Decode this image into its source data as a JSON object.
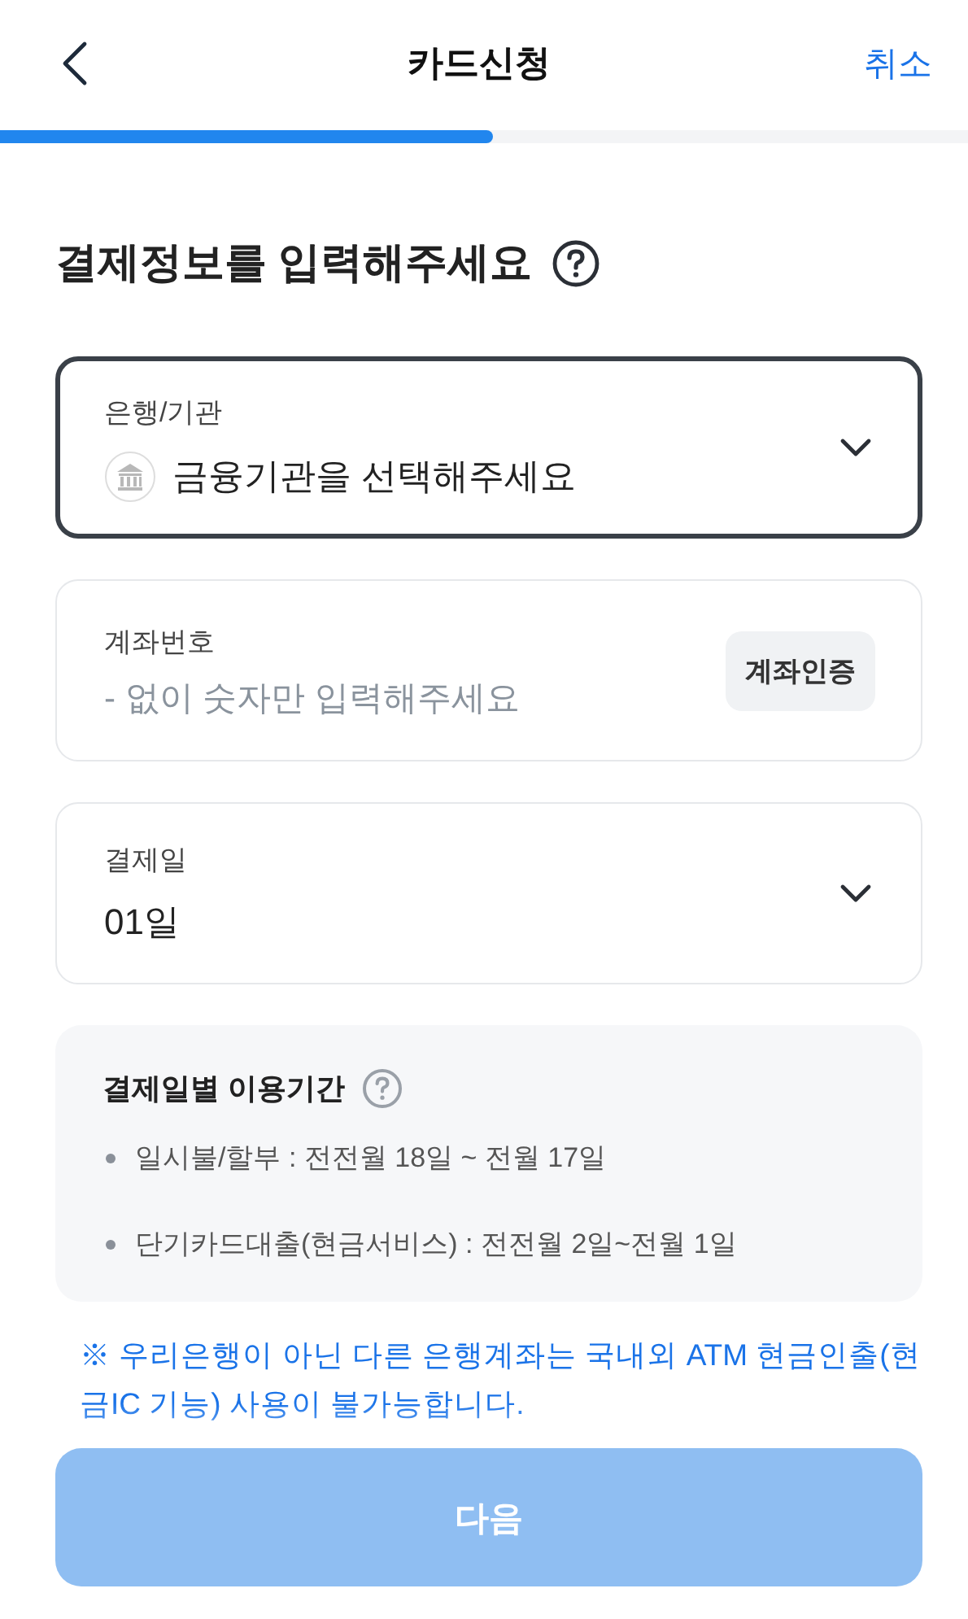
{
  "header": {
    "title": "카드신청",
    "cancel": "취소"
  },
  "progress": {
    "level": 0.51
  },
  "heading": "결제정보를 입력해주세요",
  "fields": [
    {
      "kind": "select",
      "label": "은행/기관",
      "value": "금융기관을 선택해주세요",
      "focused": true
    },
    {
      "kind": "input",
      "label": "계좌번호",
      "placeholder": "- 없이 숫자만 입력해주세요",
      "button": "계좌인증",
      "focused": false
    },
    {
      "kind": "select",
      "label": "결제일",
      "value": "01일",
      "focused": false
    }
  ],
  "info": {
    "title": "결제일별 이용기간",
    "items": [
      "일시불/할부 : 전전월 18일 ~ 전월 17일",
      "단기카드대출(현금서비스) : 전전월 2일~전월 1일"
    ]
  },
  "note": "※ 우리은행이 아닌 다른 은행계좌는 국내외 ATM 현금인출(현금IC 기능) 사용이 불가능합니다.",
  "next_button": {
    "label": "다음",
    "disabled": true
  }
}
